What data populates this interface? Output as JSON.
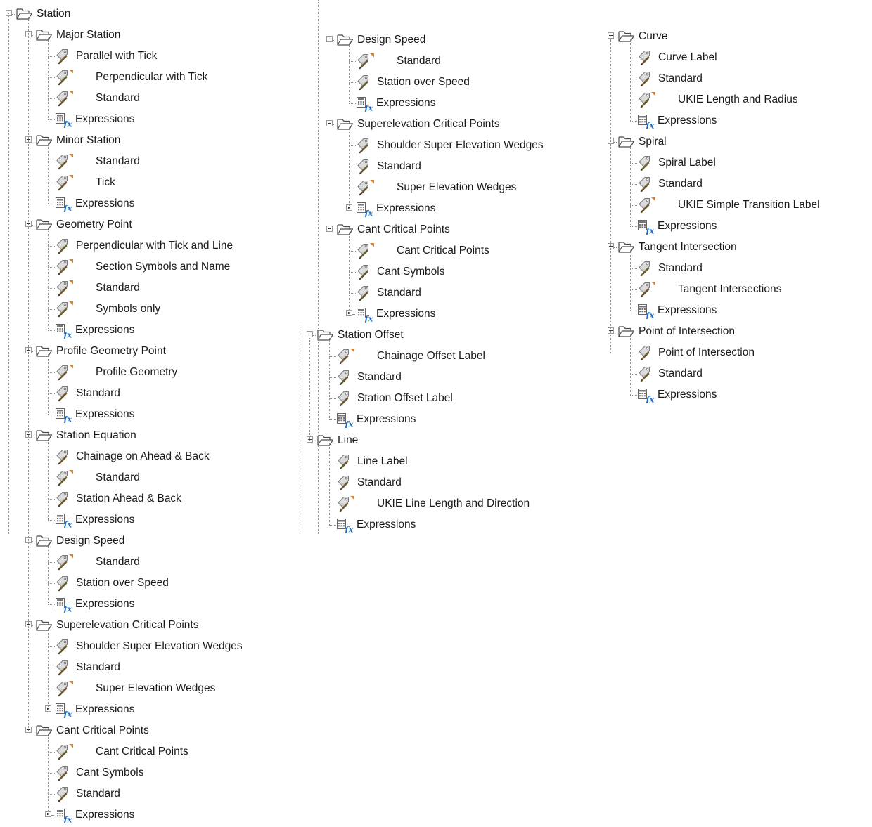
{
  "colors": {
    "folder_stroke": "#4a4a4a",
    "tag_fill": "#dcdcdc",
    "tag_stroke": "#7a7a7a",
    "pencil": "#6d5a2e",
    "override_flag": "#d9822b",
    "fx": "#1c6fc4",
    "tree_line": "#8c8c8c"
  },
  "tree": [
    {
      "label": "Station",
      "icon": "folder-icon",
      "expanded": true,
      "children": [
        {
          "label": "Major Station",
          "icon": "folder-icon",
          "expanded": true,
          "children": [
            {
              "label": "Parallel with Tick",
              "icon": "label-style-icon"
            },
            {
              "label": "Perpendicular with Tick",
              "icon": "label-style-override-icon"
            },
            {
              "label": "Standard",
              "icon": "label-style-override-icon"
            },
            {
              "label": "Expressions",
              "icon": "expressions-icon"
            }
          ]
        },
        {
          "label": "Minor Station",
          "icon": "folder-icon",
          "expanded": true,
          "children": [
            {
              "label": "Standard",
              "icon": "label-style-override-icon"
            },
            {
              "label": "Tick",
              "icon": "label-style-override-icon"
            },
            {
              "label": "Expressions",
              "icon": "expressions-icon"
            }
          ]
        },
        {
          "label": "Geometry Point",
          "icon": "folder-icon",
          "expanded": true,
          "children": [
            {
              "label": "Perpendicular with Tick and Line",
              "icon": "label-style-icon"
            },
            {
              "label": "Section Symbols and Name",
              "icon": "label-style-override-icon"
            },
            {
              "label": "Standard",
              "icon": "label-style-override-icon"
            },
            {
              "label": "Symbols only",
              "icon": "label-style-override-icon"
            },
            {
              "label": "Expressions",
              "icon": "expressions-icon"
            }
          ]
        },
        {
          "label": "Profile Geometry Point",
          "icon": "folder-icon",
          "expanded": true,
          "children": [
            {
              "label": "Profile Geometry",
              "icon": "label-style-override-icon"
            },
            {
              "label": "Standard",
              "icon": "label-style-icon"
            },
            {
              "label": "Expressions",
              "icon": "expressions-icon"
            }
          ]
        },
        {
          "label": "Station Equation",
          "icon": "folder-icon",
          "expanded": true,
          "children": [
            {
              "label": "Chainage on Ahead & Back",
              "icon": "label-style-icon"
            },
            {
              "label": "Standard",
              "icon": "label-style-override-icon"
            },
            {
              "label": "Station Ahead & Back",
              "icon": "label-style-icon"
            },
            {
              "label": "Expressions",
              "icon": "expressions-icon"
            }
          ]
        },
        {
          "label": "Design Speed",
          "icon": "folder-icon",
          "expanded": true,
          "children": [
            {
              "label": "Standard",
              "icon": "label-style-override-icon"
            },
            {
              "label": "Station over Speed",
              "icon": "label-style-icon"
            },
            {
              "label": "Expressions",
              "icon": "expressions-icon"
            }
          ]
        },
        {
          "label": "Superelevation Critical Points",
          "icon": "folder-icon",
          "expanded": true,
          "children": [
            {
              "label": "Shoulder Super Elevation Wedges",
              "icon": "label-style-icon"
            },
            {
              "label": "Standard",
              "icon": "label-style-icon"
            },
            {
              "label": "Super Elevation Wedges",
              "icon": "label-style-override-icon"
            },
            {
              "label": "Expressions",
              "icon": "expressions-icon",
              "has_subitems": true
            }
          ]
        },
        {
          "label": "Cant Critical Points",
          "icon": "folder-icon",
          "expanded": true,
          "children": [
            {
              "label": "Cant Critical Points",
              "icon": "label-style-override-icon"
            },
            {
              "label": "Cant Symbols",
              "icon": "label-style-icon"
            },
            {
              "label": "Standard",
              "icon": "label-style-icon"
            },
            {
              "label": "Expressions",
              "icon": "expressions-icon",
              "has_subitems": true
            }
          ]
        }
      ]
    },
    {
      "label": "Station Offset",
      "icon": "folder-icon",
      "expanded": true,
      "children": [
        {
          "label": "Chainage Offset Label",
          "icon": "label-style-override-icon"
        },
        {
          "label": "Standard",
          "icon": "label-style-icon"
        },
        {
          "label": "Station Offset Label",
          "icon": "label-style-icon"
        },
        {
          "label": "Expressions",
          "icon": "expressions-icon"
        }
      ]
    },
    {
      "label": "Line",
      "icon": "folder-icon",
      "expanded": true,
      "children": [
        {
          "label": "Line Label",
          "icon": "label-style-icon"
        },
        {
          "label": "Standard",
          "icon": "label-style-icon"
        },
        {
          "label": "UKIE Line Length and Direction",
          "icon": "label-style-override-icon"
        },
        {
          "label": "Expressions",
          "icon": "expressions-icon"
        }
      ]
    },
    {
      "label": "Curve",
      "icon": "folder-icon",
      "expanded": true,
      "children": [
        {
          "label": "Curve Label",
          "icon": "label-style-icon"
        },
        {
          "label": "Standard",
          "icon": "label-style-icon"
        },
        {
          "label": "UKIE Length and Radius",
          "icon": "label-style-override-icon"
        },
        {
          "label": "Expressions",
          "icon": "expressions-icon"
        }
      ]
    },
    {
      "label": "Spiral",
      "icon": "folder-icon",
      "expanded": true,
      "children": [
        {
          "label": "Spiral Label",
          "icon": "label-style-icon"
        },
        {
          "label": "Standard",
          "icon": "label-style-icon"
        },
        {
          "label": "UKIE Simple Transition Label",
          "icon": "label-style-override-icon"
        },
        {
          "label": "Expressions",
          "icon": "expressions-icon"
        }
      ]
    },
    {
      "label": "Tangent Intersection",
      "icon": "folder-icon",
      "expanded": true,
      "children": [
        {
          "label": "Standard",
          "icon": "label-style-icon"
        },
        {
          "label": "Tangent Intersections",
          "icon": "label-style-override-icon"
        },
        {
          "label": "Expressions",
          "icon": "expressions-icon"
        }
      ]
    },
    {
      "label": "Point of Intersection",
      "icon": "folder-icon",
      "expanded": true,
      "children": [
        {
          "label": "Point of Intersection",
          "icon": "label-style-icon"
        },
        {
          "label": "Standard",
          "icon": "label-style-icon"
        },
        {
          "label": "Expressions",
          "icon": "expressions-icon"
        }
      ]
    }
  ]
}
